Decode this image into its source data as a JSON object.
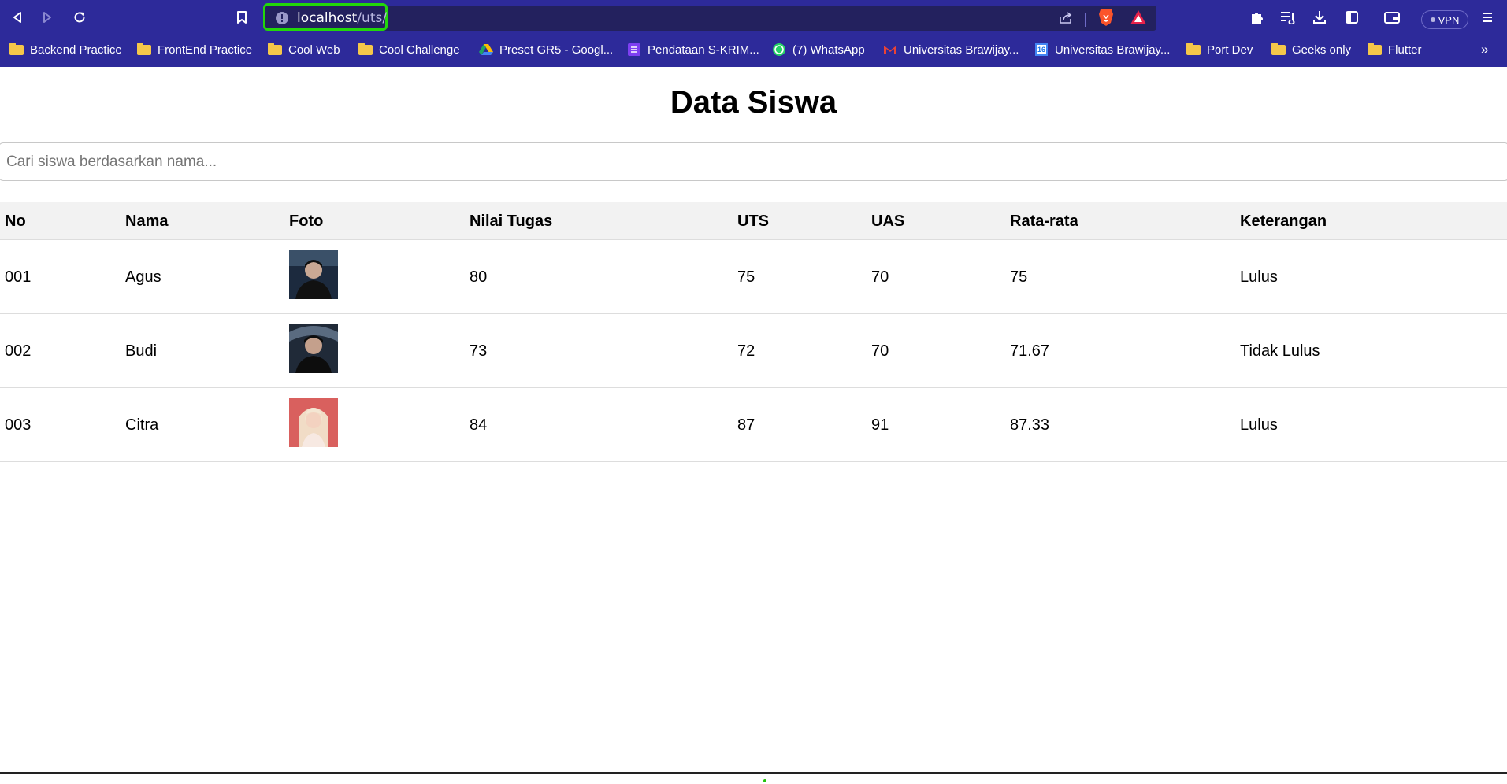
{
  "browser": {
    "url_host": "localhost",
    "url_path": "/uts/",
    "vpn_label": "VPN",
    "bookmarks_overflow": "»",
    "bookmarks": [
      {
        "label": "Backend Practice",
        "icon": "folder-icon"
      },
      {
        "label": "FrontEnd Practice",
        "icon": "folder-icon"
      },
      {
        "label": "Cool Web",
        "icon": "folder-icon"
      },
      {
        "label": "Cool Challenge",
        "icon": "folder-icon"
      },
      {
        "label": "Preset GR5 - Googl...",
        "icon": "google-drive-icon"
      },
      {
        "label": "Pendataan S-KRIM...",
        "icon": "forms-icon"
      },
      {
        "label": "(7) WhatsApp",
        "icon": "whatsapp-icon"
      },
      {
        "label": "Universitas Brawijay...",
        "icon": "gmail-icon"
      },
      {
        "label": "Universitas Brawijay...",
        "icon": "calendar-icon"
      },
      {
        "label": "Port Dev",
        "icon": "folder-icon"
      },
      {
        "label": "Geeks only",
        "icon": "folder-icon"
      },
      {
        "label": "Flutter",
        "icon": "folder-icon"
      }
    ],
    "calendar_day": "16",
    "colors": {
      "chrome": "#2d2a9a",
      "url_bar": "#23215e",
      "highlight": "#22d60a"
    }
  },
  "page": {
    "title": "Data Siswa",
    "search_placeholder": "Cari siswa berdasarkan nama...",
    "table": {
      "headers": [
        "No",
        "Nama",
        "Foto",
        "Nilai Tugas",
        "UTS",
        "UAS",
        "Rata-rata",
        "Keterangan"
      ],
      "rows": [
        {
          "no": "001",
          "nama": "Agus",
          "foto": "photo-male-dark",
          "tugas": "80",
          "uts": "75",
          "uas": "70",
          "rata": "75",
          "ket": "Lulus"
        },
        {
          "no": "002",
          "nama": "Budi",
          "foto": "photo-male-dark",
          "tugas": "73",
          "uts": "72",
          "uas": "70",
          "rata": "71.67",
          "ket": "Tidak Lulus"
        },
        {
          "no": "003",
          "nama": "Citra",
          "foto": "photo-female-pink",
          "tugas": "84",
          "uts": "87",
          "uas": "91",
          "rata": "87.33",
          "ket": "Lulus"
        }
      ]
    }
  }
}
